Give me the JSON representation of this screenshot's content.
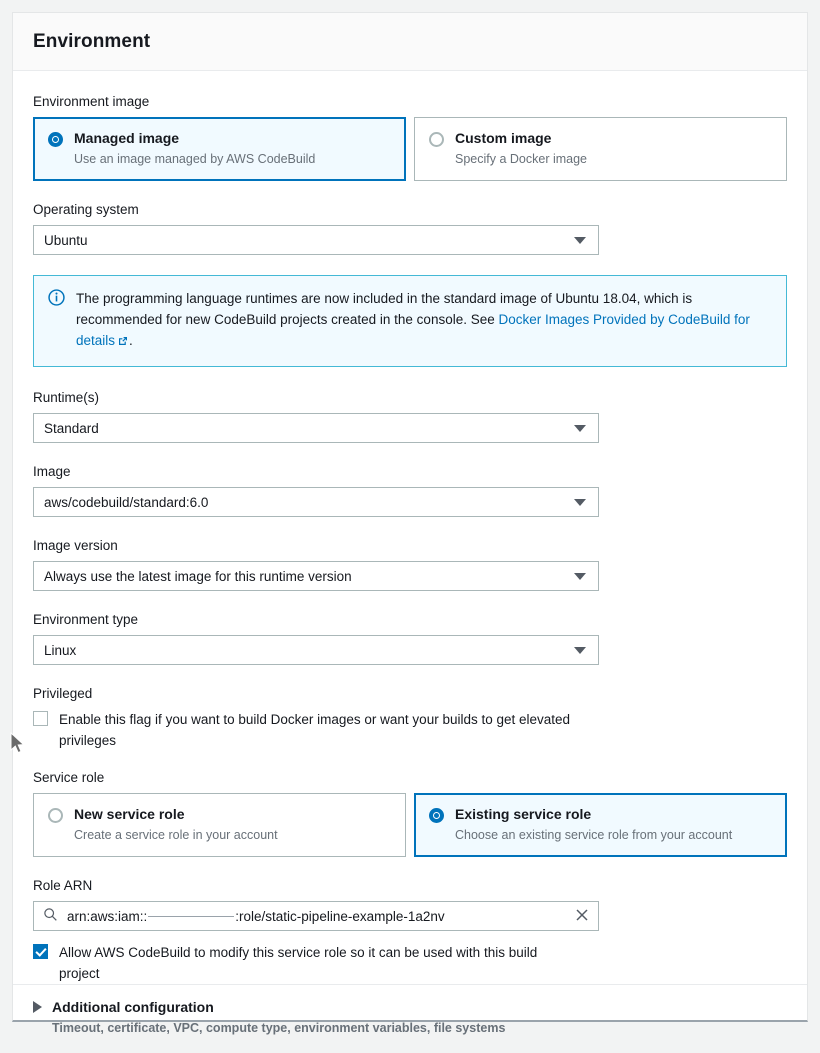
{
  "panel": {
    "title": "Environment"
  },
  "environment_image": {
    "label": "Environment image",
    "options": [
      {
        "title": "Managed image",
        "description": "Use an image managed by AWS CodeBuild",
        "selected": true
      },
      {
        "title": "Custom image",
        "description": "Specify a Docker image",
        "selected": false
      }
    ]
  },
  "operating_system": {
    "label": "Operating system",
    "value": "Ubuntu"
  },
  "info_alert": {
    "icon": "info-circle-icon",
    "text_before_link": "The programming language runtimes are now included in the standard image of Ubuntu 18.04, which is recommended for new CodeBuild projects created in the console. See ",
    "link_text": "Docker Images Provided by CodeBuild for details",
    "external_icon": "external-link-icon",
    "text_after_link": ".",
    "border_color": "#44b9d6",
    "background_color": "#f1faff"
  },
  "runtimes": {
    "label": "Runtime(s)",
    "value": "Standard"
  },
  "image": {
    "label": "Image",
    "value": "aws/codebuild/standard:6.0"
  },
  "image_version": {
    "label": "Image version",
    "value": "Always use the latest image for this runtime version"
  },
  "environment_type": {
    "label": "Environment type",
    "value": "Linux"
  },
  "privileged": {
    "label": "Privileged",
    "checkbox_label": "Enable this flag if you want to build Docker images or want your builds to get elevated privileges",
    "checked": false
  },
  "service_role": {
    "label": "Service role",
    "options": [
      {
        "title": "New service role",
        "description": "Create a service role in your account",
        "selected": false
      },
      {
        "title": "Existing service role",
        "description": "Choose an existing service role from your account",
        "selected": true
      }
    ]
  },
  "role_arn": {
    "label": "Role ARN",
    "search_icon": "search-icon",
    "clear_icon": "close-icon",
    "value_prefix": "arn:aws:iam::",
    "value_suffix": ":role/static-pipeline-example-1a2nv",
    "redacted": true
  },
  "allow_modify": {
    "label": "Allow AWS CodeBuild to modify this service role so it can be used with this build project",
    "checked": true
  },
  "additional_configuration": {
    "expander_icon": "triangle-right-icon",
    "title": "Additional configuration",
    "subtitle": "Timeout, certificate, VPC, compute type, environment variables, file systems",
    "expanded": false
  },
  "theme": {
    "accent": "#0073bb",
    "selected_bg": "#f1faff",
    "border": "#aab7b8",
    "text": "#16191f",
    "muted": "#687078",
    "page_bg": "#f2f3f3"
  }
}
